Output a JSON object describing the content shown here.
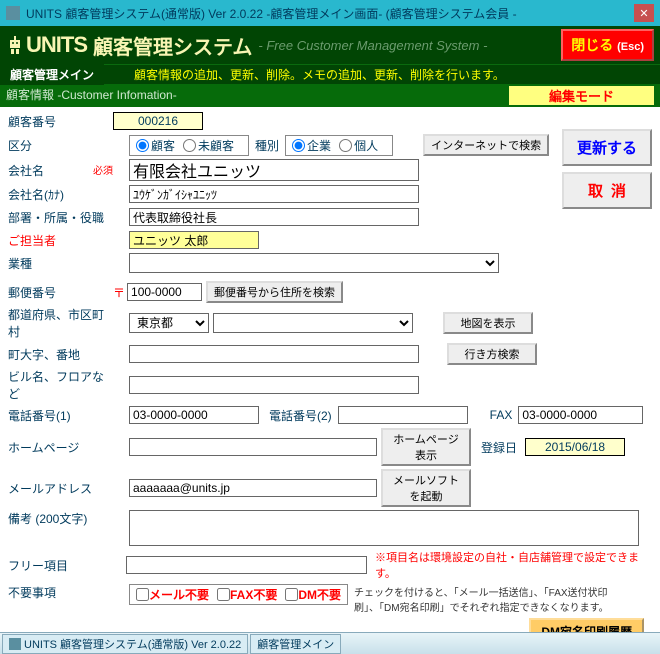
{
  "titlebar": {
    "text": "UNITS 顧客管理システム(通常版)  Ver 2.0.22 -顧客管理メイン画面- (顧客管理システム会員 -",
    "close_x": "✕"
  },
  "header": {
    "logo": "UNITS",
    "jp": "顧客管理システム",
    "sub": "- Free Customer Management System -",
    "close_label": "閉じる",
    "close_esc": "(Esc)"
  },
  "subheader": {
    "left": "顧客管理メイン",
    "right": "顧客情報の追加、更新、削除。メモの追加、更新、削除を行います。"
  },
  "section": {
    "title": "顧客情報 -Customer Infomation-",
    "edit_mode": "編集モード"
  },
  "labels": {
    "customer_no": "顧客番号",
    "category": "区分",
    "company": "会社名",
    "company_kana": "会社名(ｶﾅ)",
    "division": "部署・所属・役職",
    "contact": "ご担当者",
    "industry": "業種",
    "postal": "郵便番号",
    "prefecture": "都道府県、市区町村",
    "address1": "町大字、番地",
    "address2": "ビル名、フロアなど",
    "tel1": "電話番号(1)",
    "tel2": "電話番号(2)",
    "fax": "FAX",
    "homepage": "ホームページ",
    "email": "メールアドレス",
    "memo": "備考 (200文字)",
    "free": "フリー項目",
    "unwanted": "不要事項",
    "reg_date": "登録日",
    "type": "種別",
    "required": "必須"
  },
  "values": {
    "customer_no": "000216",
    "company": "有限会社ユニッツ",
    "company_kana": "ﾕｳｹﾞﾝｶﾞｲｼｬﾕﾆｯﾂ",
    "division": "代表取締役社長",
    "contact": "ユニッツ 太郎",
    "postal": "100-0000",
    "prefecture": "東京都",
    "tel1": "03-0000-0000",
    "fax": "03-0000-0000",
    "email": "aaaaaaa@units.jp",
    "reg_date": "2015/06/18"
  },
  "radios": {
    "cat_customer": "顧客",
    "cat_noncustomer": "未顧客",
    "type_company": "企業",
    "type_person": "個人"
  },
  "buttons": {
    "internet_search": "インターネットで検索",
    "update": "更新する",
    "cancel": "取消",
    "postal_search": "郵便番号から住所を検索",
    "show_map": "地図を表示",
    "route_search": "行き方検索",
    "hp_show": "ホームページ表示",
    "mail_launch": "メールソフトを起動",
    "dm_history": "DM宛名印刷履歴"
  },
  "checks": {
    "mail": "メール不要",
    "fax": "FAX不要",
    "dm": "DM不要"
  },
  "notes": {
    "free_note": "※項目名は環境設定の自社・自店舗管理で設定できます。",
    "check_note": "チェックを付けると、「メール一括送信」、「FAX送付状印刷」、「DM宛名印刷」でそれぞれ指定できなくなります。"
  },
  "taskbar": {
    "item1": "UNITS 顧客管理システム(通常版) Ver 2.0.22",
    "item2": "顧客管理メイン"
  }
}
